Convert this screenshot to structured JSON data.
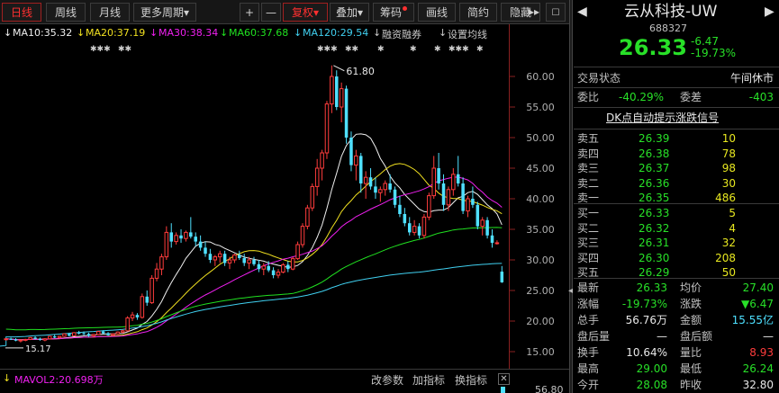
{
  "toolbar": {
    "periods": [
      "日线",
      "周线",
      "月线",
      "更多周期"
    ],
    "plus": "+",
    "minus": "—",
    "adjust": "复权",
    "overlay": "叠加",
    "chips": "筹码",
    "draw": "画线",
    "simple": "简约",
    "hide": "隐藏",
    "more": "▸▸"
  },
  "ma_legend": [
    {
      "label": "MA10:35.32",
      "color": "#f0f0f0"
    },
    {
      "label": "MA20:37.19",
      "color": "#f0e020"
    },
    {
      "label": "MA30:38.34",
      "color": "#f020f0"
    },
    {
      "label": "MA60:37.68",
      "color": "#20e020"
    },
    {
      "label": "MA120:29.54",
      "color": "#40d0f0"
    },
    {
      "label": "融资融券",
      "color": "#c8c8c8"
    },
    {
      "label": "设置均线",
      "color": "#c8c8c8"
    }
  ],
  "stars": [
    "✱✱✱",
    "✱✱",
    "✱✱✱",
    "✱✱",
    "✱",
    "✱",
    "✱",
    "✱✱✱",
    "✱"
  ],
  "price_axis": [
    "60.00",
    "55.00",
    "50.00",
    "45.00",
    "40.00",
    "35.00",
    "30.00",
    "25.00",
    "20.00",
    "15.00"
  ],
  "high_marker": "61.80",
  "low_marker": "15.17",
  "volume_bar": {
    "label": "MAVOL2:20.698万",
    "buttons": [
      "改参数",
      "加指标",
      "换指标"
    ],
    "axis_value": "56.80"
  },
  "quote": {
    "name": "云从科技-UW",
    "code": "688327",
    "price": "26.33",
    "change": "-6.47",
    "change_pct": "-19.73%",
    "trade_status_label": "交易状态",
    "trade_status": "午间休市",
    "weibi_label": "委比",
    "weibi": "-40.29%",
    "weicha_label": "委差",
    "weicha": "-403",
    "dk_signal": "DK点自动提示涨跌信号",
    "asks": [
      {
        "label": "卖五",
        "price": "26.39",
        "vol": "10"
      },
      {
        "label": "卖四",
        "price": "26.38",
        "vol": "78"
      },
      {
        "label": "卖三",
        "price": "26.37",
        "vol": "98"
      },
      {
        "label": "卖二",
        "price": "26.36",
        "vol": "30"
      },
      {
        "label": "卖一",
        "price": "26.35",
        "vol": "486"
      }
    ],
    "bids": [
      {
        "label": "买一",
        "price": "26.33",
        "vol": "5"
      },
      {
        "label": "买二",
        "price": "26.32",
        "vol": "4"
      },
      {
        "label": "买三",
        "price": "26.31",
        "vol": "32"
      },
      {
        "label": "买四",
        "price": "26.30",
        "vol": "208"
      },
      {
        "label": "买五",
        "price": "26.29",
        "vol": "50"
      }
    ],
    "stats": [
      {
        "l1": "最新",
        "v1": "26.33",
        "c1": "green",
        "l2": "均价",
        "v2": "27.40",
        "c2": "green"
      },
      {
        "l1": "涨幅",
        "v1": "-19.73%",
        "c1": "green",
        "l2": "涨跌",
        "v2": "▼6.47",
        "c2": "green"
      },
      {
        "l1": "总手",
        "v1": "56.76万",
        "c1": "white",
        "l2": "金额",
        "v2": "15.55亿",
        "c2": "cyan"
      },
      {
        "l1": "盘后量",
        "v1": "—",
        "c1": "white",
        "l2": "盘后额",
        "v2": "—",
        "c2": "white"
      },
      {
        "l1": "换手",
        "v1": "10.64%",
        "c1": "white",
        "l2": "量比",
        "v2": "8.93",
        "c2": "red"
      },
      {
        "l1": "最高",
        "v1": "29.00",
        "c1": "green",
        "l2": "最低",
        "v2": "26.24",
        "c2": "green"
      },
      {
        "l1": "今开",
        "v1": "28.08",
        "c1": "green",
        "l2": "昨收",
        "v2": "32.80",
        "c2": "white"
      }
    ]
  },
  "chart_data": {
    "type": "candlestick",
    "ylim": [
      15,
      62
    ],
    "candles": [
      [
        17.0,
        17.2,
        16.8,
        17.1
      ],
      [
        17.1,
        17.3,
        16.9,
        17.0
      ],
      [
        17.0,
        17.2,
        16.7,
        16.8
      ],
      [
        16.8,
        17.0,
        16.5,
        16.9
      ],
      [
        16.9,
        17.1,
        16.7,
        17.0
      ],
      [
        17.0,
        17.4,
        16.9,
        17.3
      ],
      [
        17.3,
        17.5,
        17.0,
        17.1
      ],
      [
        17.1,
        17.3,
        16.8,
        16.9
      ],
      [
        16.9,
        17.2,
        16.7,
        17.1
      ],
      [
        17.1,
        17.6,
        17.0,
        17.5
      ],
      [
        17.5,
        17.8,
        17.2,
        17.3
      ],
      [
        17.3,
        17.6,
        17.1,
        17.5
      ],
      [
        17.5,
        18.0,
        17.4,
        17.9
      ],
      [
        17.9,
        18.1,
        17.5,
        17.6
      ],
      [
        17.6,
        18.2,
        17.5,
        18.1
      ],
      [
        18.1,
        18.4,
        17.8,
        18.0
      ],
      [
        18.0,
        18.3,
        17.7,
        17.9
      ],
      [
        17.9,
        18.1,
        17.4,
        17.6
      ],
      [
        17.6,
        17.9,
        17.3,
        17.8
      ],
      [
        17.8,
        18.4,
        17.7,
        18.3
      ],
      [
        18.3,
        18.5,
        17.9,
        18.0
      ],
      [
        18.0,
        18.2,
        17.6,
        17.7
      ],
      [
        17.7,
        18.0,
        17.5,
        17.9
      ],
      [
        17.9,
        18.3,
        17.8,
        18.2
      ],
      [
        18.2,
        18.6,
        18.0,
        18.4
      ],
      [
        18.4,
        20.8,
        18.3,
        20.5
      ],
      [
        20.5,
        21.5,
        20.0,
        21.0
      ],
      [
        21.0,
        21.3,
        20.2,
        20.6
      ],
      [
        20.6,
        24.5,
        20.4,
        24.0
      ],
      [
        24.0,
        25.0,
        22.5,
        23.0
      ],
      [
        23.0,
        27.5,
        22.8,
        27.0
      ],
      [
        27.0,
        29.5,
        26.5,
        28.5
      ],
      [
        28.5,
        31.0,
        27.5,
        30.5
      ],
      [
        30.5,
        35.5,
        30.0,
        34.5
      ],
      [
        34.5,
        36.0,
        32.0,
        33.0
      ],
      [
        33.0,
        34.5,
        32.5,
        34.0
      ],
      [
        34.0,
        35.0,
        32.8,
        33.5
      ],
      [
        33.5,
        34.8,
        33.0,
        34.5
      ],
      [
        34.5,
        37.0,
        33.5,
        33.8
      ],
      [
        33.8,
        34.5,
        32.2,
        33.0
      ],
      [
        33.0,
        34.0,
        31.5,
        32.0
      ],
      [
        32.0,
        33.0,
        30.5,
        31.0
      ],
      [
        31.0,
        31.8,
        29.5,
        30.0
      ],
      [
        30.0,
        30.8,
        29.0,
        30.5
      ],
      [
        30.5,
        31.5,
        29.5,
        31.0
      ],
      [
        31.0,
        31.5,
        29.0,
        29.5
      ],
      [
        29.5,
        30.5,
        28.5,
        30.0
      ],
      [
        30.0,
        31.0,
        29.5,
        30.8
      ],
      [
        30.8,
        31.5,
        30.0,
        30.3
      ],
      [
        30.3,
        31.0,
        29.0,
        29.5
      ],
      [
        29.5,
        30.5,
        28.5,
        30.0
      ],
      [
        30.0,
        30.5,
        29.0,
        29.3
      ],
      [
        29.3,
        30.0,
        28.0,
        28.5
      ],
      [
        28.5,
        29.5,
        27.5,
        29.0
      ],
      [
        29.0,
        29.8,
        28.0,
        28.3
      ],
      [
        28.3,
        28.8,
        27.0,
        27.5
      ],
      [
        27.5,
        28.5,
        27.0,
        28.0
      ],
      [
        28.0,
        29.5,
        27.8,
        29.2
      ],
      [
        29.2,
        29.8,
        28.0,
        28.5
      ],
      [
        28.5,
        30.5,
        28.3,
        30.2
      ],
      [
        30.2,
        33.0,
        30.0,
        32.5
      ],
      [
        32.5,
        36.0,
        32.0,
        35.5
      ],
      [
        35.5,
        39.0,
        35.0,
        38.5
      ],
      [
        38.5,
        42.5,
        38.0,
        42.0
      ],
      [
        42.0,
        46.5,
        40.5,
        45.0
      ],
      [
        45.0,
        48.0,
        43.0,
        47.5
      ],
      [
        47.5,
        56.0,
        46.5,
        55.5
      ],
      [
        55.5,
        61.8,
        54.0,
        60.0
      ],
      [
        60.0,
        61.0,
        54.5,
        55.0
      ],
      [
        55.0,
        59.0,
        52.5,
        58.0
      ],
      [
        58.0,
        58.5,
        49.0,
        50.0
      ],
      [
        50.0,
        51.0,
        44.5,
        45.5
      ],
      [
        45.5,
        48.0,
        43.0,
        47.0
      ],
      [
        47.0,
        47.5,
        41.0,
        42.5
      ],
      [
        42.5,
        44.5,
        40.0,
        43.5
      ],
      [
        43.5,
        45.0,
        41.5,
        42.0
      ],
      [
        42.0,
        43.5,
        40.0,
        41.0
      ],
      [
        41.0,
        42.0,
        39.5,
        41.5
      ],
      [
        41.5,
        43.0,
        40.5,
        42.5
      ],
      [
        42.5,
        44.0,
        41.0,
        41.5
      ],
      [
        41.5,
        42.0,
        38.5,
        39.0
      ],
      [
        39.0,
        40.5,
        37.0,
        37.5
      ],
      [
        37.5,
        38.5,
        35.5,
        36.0
      ],
      [
        36.0,
        37.0,
        34.0,
        34.5
      ],
      [
        34.5,
        36.5,
        34.0,
        35.5
      ],
      [
        35.5,
        36.0,
        33.5,
        34.0
      ],
      [
        34.0,
        37.5,
        33.5,
        37.0
      ],
      [
        37.0,
        41.0,
        36.5,
        40.5
      ],
      [
        40.5,
        47.0,
        40.0,
        45.0
      ],
      [
        45.0,
        47.5,
        41.5,
        42.5
      ],
      [
        42.5,
        44.0,
        38.0,
        39.0
      ],
      [
        39.0,
        42.0,
        38.0,
        41.5
      ],
      [
        41.5,
        45.0,
        40.5,
        44.0
      ],
      [
        44.0,
        47.0,
        42.0,
        42.5
      ],
      [
        42.5,
        43.5,
        37.5,
        38.0
      ],
      [
        38.0,
        40.5,
        37.0,
        40.0
      ],
      [
        40.0,
        42.0,
        38.5,
        39.0
      ],
      [
        39.0,
        39.5,
        35.0,
        35.5
      ],
      [
        35.5,
        37.0,
        34.0,
        36.5
      ],
      [
        36.5,
        37.0,
        33.5,
        34.0
      ],
      [
        34.0,
        35.0,
        32.0,
        32.8
      ],
      [
        32.8,
        33.2,
        32.5,
        32.8
      ],
      [
        28.08,
        29.0,
        26.24,
        26.33
      ]
    ]
  }
}
